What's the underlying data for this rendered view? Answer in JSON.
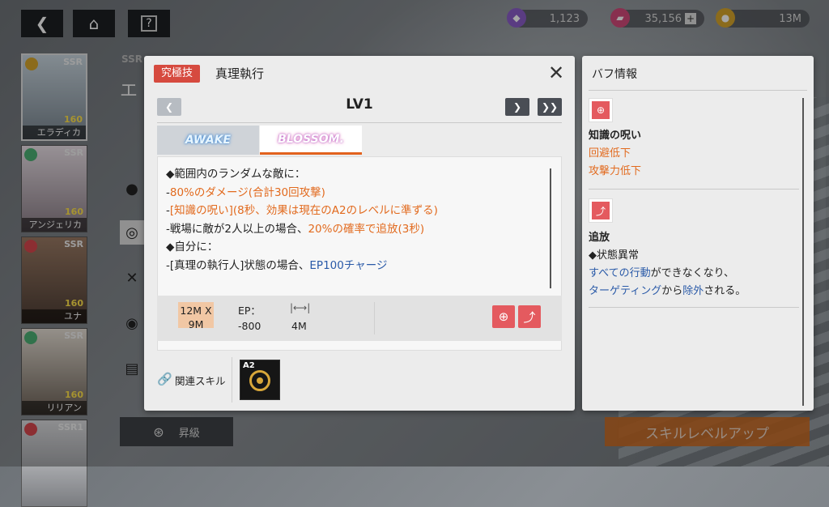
{
  "top": {
    "resources": [
      {
        "icon": "gem-icon",
        "value": "1,123",
        "color": "#8b5cc8"
      },
      {
        "icon": "ticket-icon",
        "value": "35,156",
        "color": "#d24a7a"
      },
      {
        "icon": "coin-icon",
        "value": "13M",
        "color": "#d6a52c"
      }
    ]
  },
  "roster": [
    {
      "rarity": "SSR",
      "level": "160",
      "name": "エラディカ",
      "color": "#d6a52c"
    },
    {
      "rarity": "SSR",
      "level": "160",
      "name": "アンジェリカ",
      "color": "#4caf73"
    },
    {
      "rarity": "SSR",
      "level": "160",
      "name": "ユナ",
      "color": "#d8484e"
    },
    {
      "rarity": "SSR",
      "level": "160",
      "name": "リリアン",
      "color": "#4caf73"
    },
    {
      "rarity": "SSR1",
      "level": "",
      "name": "",
      "color": "#d8484e"
    }
  ],
  "bg_partial": {
    "rarity": "SSR",
    "name_initial": "エ"
  },
  "modal": {
    "tag": "究極技",
    "title": "真理執行",
    "level": "LV1",
    "tabs": {
      "awake": "AWAKE",
      "blossom": "BLOSSOM."
    },
    "desc": [
      {
        "parts": [
          {
            "t": "◆範囲内のランダムな敵に：",
            "c": ""
          }
        ]
      },
      {
        "parts": [
          {
            "t": "-",
            "c": ""
          },
          {
            "t": "80%のダメージ(合計30回攻撃)",
            "c": "orange"
          }
        ]
      },
      {
        "parts": [
          {
            "t": "-",
            "c": ""
          },
          {
            "t": "[知識の呪い](8秒、効果は現在のA2のレベルに準ずる)",
            "c": "orange"
          }
        ]
      },
      {
        "parts": [
          {
            "t": "-戦場に敵が2人以上の場合、",
            "c": ""
          },
          {
            "t": "20%の確率で追放(3秒)",
            "c": "orange"
          }
        ]
      },
      {
        "parts": [
          {
            "t": "◆自分に：",
            "c": ""
          }
        ]
      },
      {
        "parts": [
          {
            "t": "-[真理の執行人]状態の場合、",
            "c": ""
          },
          {
            "t": "EP100チャージ",
            "c": "blue"
          }
        ]
      }
    ],
    "range": "12M X 9M",
    "ep_label": "EP：",
    "ep_value": "-800",
    "distance": "4M",
    "related_label": "関連スキル",
    "related_skill": "A2"
  },
  "buff": {
    "title": "バフ情報",
    "sections": [
      {
        "name": "知識の呪い",
        "lines": [
          [
            {
              "t": "回避低下",
              "c": "orange"
            }
          ],
          [
            {
              "t": "攻撃力低下",
              "c": "orange"
            }
          ]
        ]
      },
      {
        "name": "追放",
        "lines": [
          [
            {
              "t": "◆状態異常",
              "c": ""
            }
          ],
          [
            {
              "t": "すべての行動",
              "c": "blue"
            },
            {
              "t": "ができなくなり、",
              "c": ""
            }
          ],
          [
            {
              "t": "ターゲティング",
              "c": "blue"
            },
            {
              "t": "から",
              "c": ""
            },
            {
              "t": "除外",
              "c": "blue"
            },
            {
              "t": "される。",
              "c": ""
            }
          ]
        ]
      }
    ]
  },
  "buttons": {
    "upgrade": "昇級",
    "skill_level_up": "スキルレベルアップ"
  }
}
